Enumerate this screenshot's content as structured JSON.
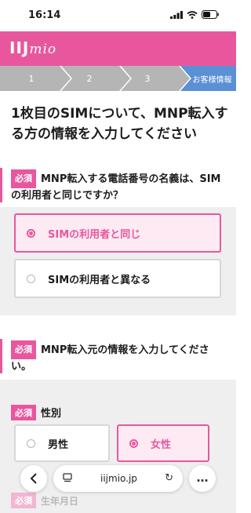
{
  "status": {
    "time": "16:14",
    "signal": "signal-icon",
    "wifi": "wifi-icon",
    "battery": "battery-icon"
  },
  "brand": {
    "logo_main": "IIJ",
    "logo_sub": "mio",
    "color": "#e8579e"
  },
  "steps": [
    "1",
    "2",
    "3",
    "お客様情報"
  ],
  "page_title": "1枚目のSIMについて、MNP転入する方の情報を入力してください",
  "q1": {
    "required": "必須",
    "text": "MNP転入する電話番号の名義は、SIMの利用者と同じですか？",
    "options": [
      {
        "label": "SIMの利用者と同じ",
        "selected": true
      },
      {
        "label": "SIMの利用者と異なる",
        "selected": false
      }
    ]
  },
  "q2": {
    "required": "必須",
    "text": "MNP転入元の情報を入力してください。"
  },
  "gender": {
    "required": "必須",
    "label": "性別",
    "options": [
      {
        "label": "男性",
        "selected": false
      },
      {
        "label": "女性",
        "selected": true
      }
    ]
  },
  "birth": {
    "required": "必須",
    "label": "生年月日"
  },
  "browser": {
    "url": "iijmio.jp",
    "back": "‹",
    "more": "…"
  },
  "colors": {
    "accent": "#e8579e",
    "step_active": "#5b8fd6",
    "step_inactive": "#b5b5b5"
  }
}
